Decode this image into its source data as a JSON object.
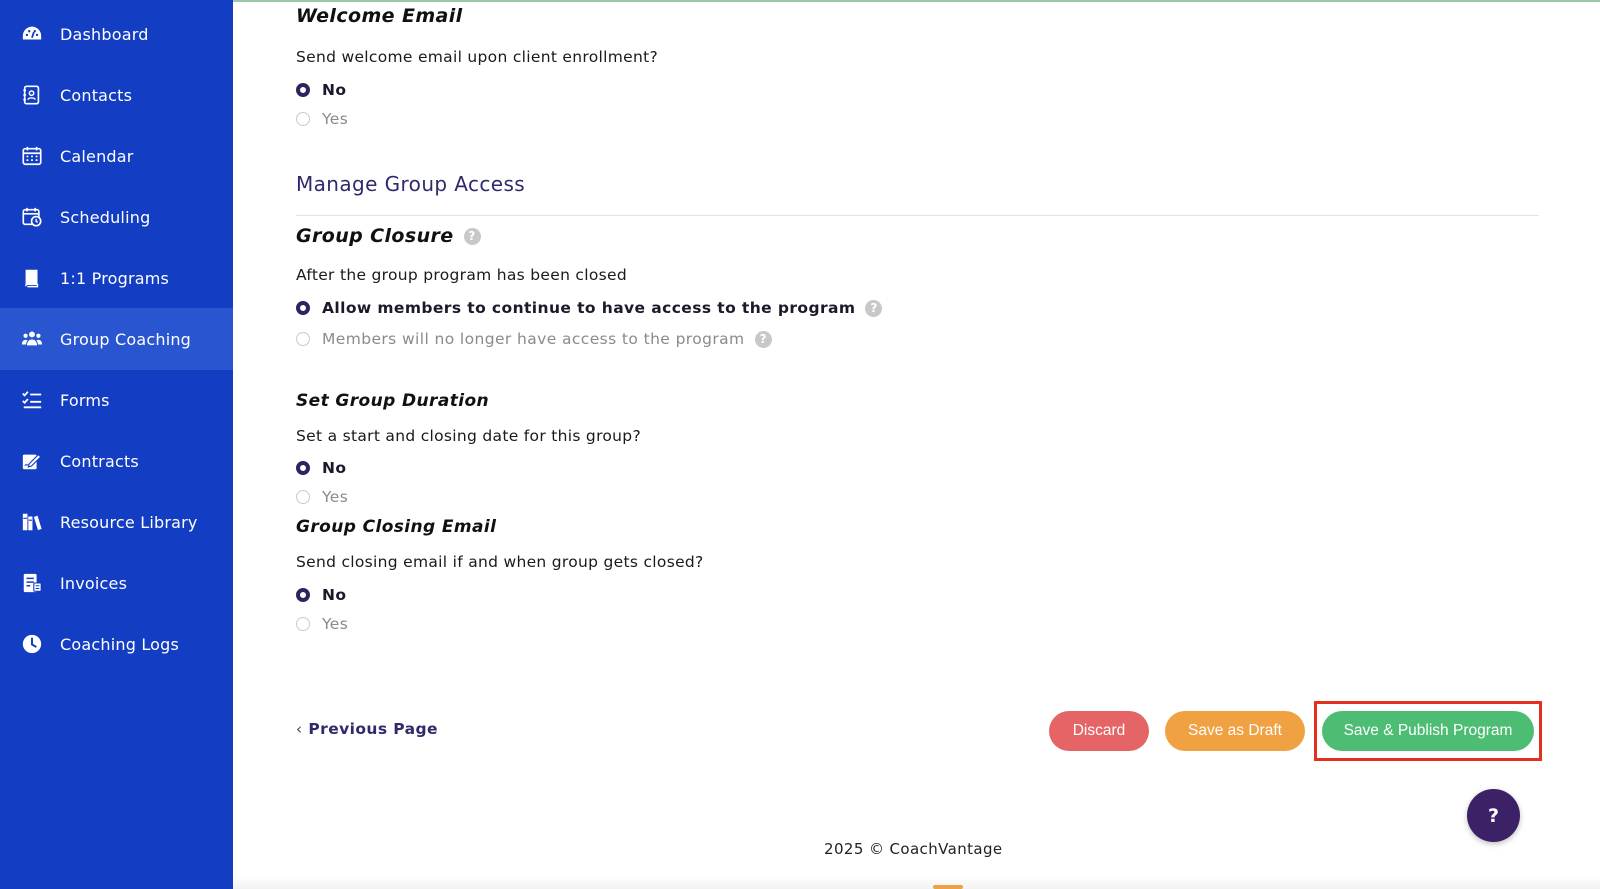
{
  "colors": {
    "sidebar_bg": "#133dc2",
    "sidebar_active": "#2a55d0",
    "accent_dark": "#2f2a6b",
    "discard": "#e56466",
    "draft": "#f0a142",
    "publish": "#4cbd72",
    "highlight": "#e3301f",
    "help_fab": "#3d2167"
  },
  "sidebar": {
    "items": [
      {
        "label": "Dashboard",
        "icon": "dashboard-gauge-icon",
        "active": false
      },
      {
        "label": "Contacts",
        "icon": "contacts-book-icon",
        "active": false
      },
      {
        "label": "Calendar",
        "icon": "calendar-icon",
        "active": false
      },
      {
        "label": "Scheduling",
        "icon": "calendar-clock-icon",
        "active": false
      },
      {
        "label": "1:1 Programs",
        "icon": "book-icon",
        "active": false
      },
      {
        "label": "Group Coaching",
        "icon": "users-group-icon",
        "active": true
      },
      {
        "label": "Forms",
        "icon": "checklist-icon",
        "active": false
      },
      {
        "label": "Contracts",
        "icon": "signature-icon",
        "active": false
      },
      {
        "label": "Resource Library",
        "icon": "books-icon",
        "active": false
      },
      {
        "label": "Invoices",
        "icon": "invoice-icon",
        "active": false
      },
      {
        "label": "Coaching Logs",
        "icon": "clock-icon",
        "active": false
      }
    ]
  },
  "welcome_email": {
    "title": "Welcome Email",
    "question": "Send welcome email upon client enrollment?",
    "options": [
      "No",
      "Yes"
    ],
    "selected": "No"
  },
  "group_access": {
    "header": "Manage Group Access",
    "closure": {
      "title": "Group Closure",
      "question": "After the group program has been closed",
      "options": [
        "Allow members to continue to have access to the program",
        "Members will no longer have access to the program"
      ],
      "selected": "Allow members to continue to have access to the program"
    },
    "duration": {
      "title": "Set Group Duration",
      "question": "Set a start and closing date for this group?",
      "options": [
        "No",
        "Yes"
      ],
      "selected": "No"
    },
    "closing_email": {
      "title": "Group Closing Email",
      "question": "Send closing email if and when group gets closed?",
      "options": [
        "No",
        "Yes"
      ],
      "selected": "No"
    }
  },
  "help_glyph": "?",
  "actions": {
    "previous": "Previous Page",
    "discard": "Discard",
    "draft": "Save as Draft",
    "publish": "Save & Publish Program"
  },
  "footer": "2025 © CoachVantage"
}
